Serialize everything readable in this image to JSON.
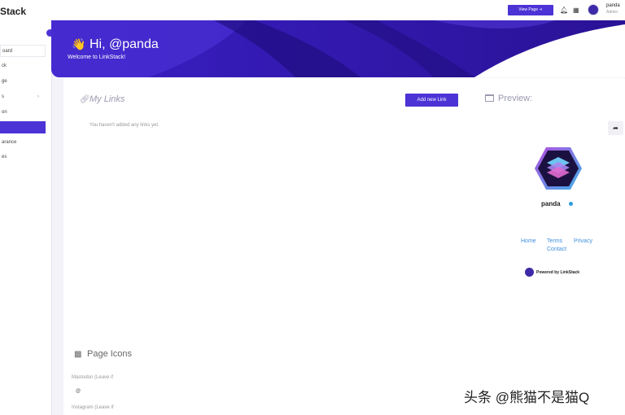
{
  "app": {
    "brand": "Stack"
  },
  "sidebar": {
    "items": [
      {
        "label": "oard"
      },
      {
        "label": "ck"
      },
      {
        "label": "ge"
      },
      {
        "label": "s"
      },
      {
        "label": "on"
      },
      {
        "label": ""
      },
      {
        "label": "arance"
      },
      {
        "label": "es"
      }
    ]
  },
  "topbar": {
    "view_page_label": "View Page",
    "user_name": "panda",
    "user_role": "Admin"
  },
  "hero": {
    "wave": "👋",
    "title": "Hi, @panda",
    "subtitle": "Welcome to LinkStack!"
  },
  "links": {
    "title": "My Links",
    "add_button": "Add new Link",
    "empty_message": "You haven't added any links yet."
  },
  "preview": {
    "title": "Preview:",
    "profile_name": "panda",
    "links": [
      "Home",
      "Terms",
      "Privacy",
      "Contact"
    ],
    "powered_by": "Powered by LinkStack"
  },
  "page_icons": {
    "title": "Page Icons",
    "fields": [
      {
        "label": "Mastodon (Leave if",
        "value": "@"
      },
      {
        "label": "Instagram (Leave if",
        "value": ""
      }
    ]
  },
  "watermark": "头条 @熊猫不是猫Q",
  "colors": {
    "accent": "#4b33d6",
    "hero_dark": "#26128f",
    "link": "#3f8fe0"
  },
  "icons": {
    "wave": "wave-emoji",
    "links": "link-icon",
    "preview": "browser-window-icon",
    "share": "share-icon",
    "page_icons": "qr-code-icon"
  }
}
